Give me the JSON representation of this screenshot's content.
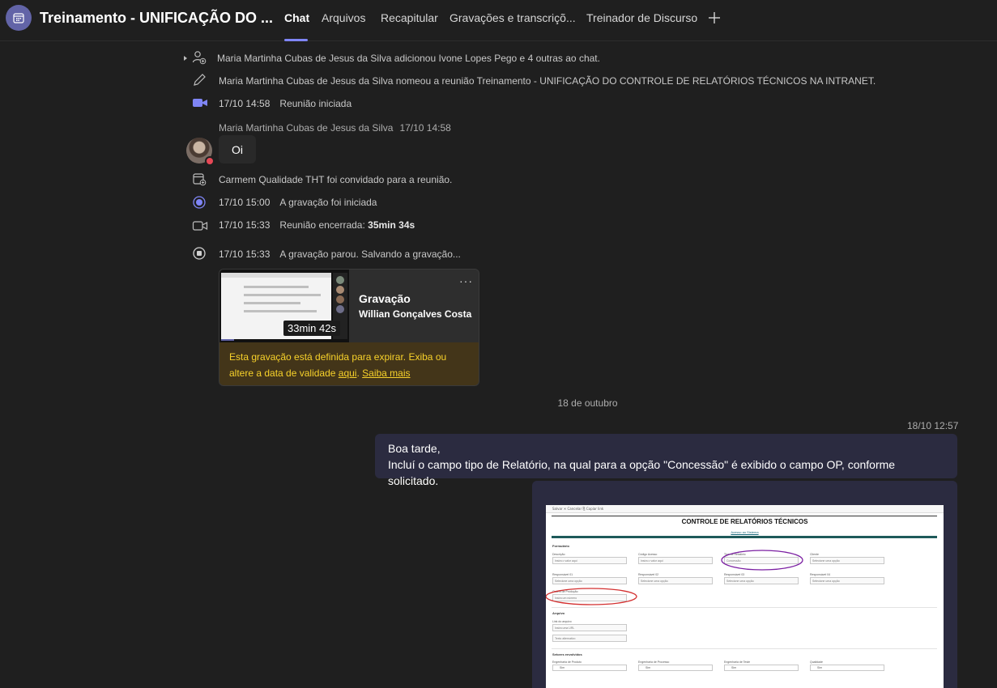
{
  "header": {
    "title": "Treinamento - UNIFICAÇÃO DO ...",
    "tabs": [
      {
        "label": "Chat",
        "active": true
      },
      {
        "label": "Arquivos"
      },
      {
        "label": "Recapitular"
      },
      {
        "label": "Gravações e transcriçõ..."
      },
      {
        "label": "Treinador de Discurso"
      }
    ],
    "add_tab_icon": "plus-icon",
    "accent_color": "#7f85f5"
  },
  "events": {
    "added": "Maria Martinha Cubas de Jesus da Silva adicionou Ivone Lopes Pego e 4 outras ao chat.",
    "renamed": "Maria Martinha Cubas de Jesus da Silva nomeou a reunião Treinamento - UNIFICAÇÃO DO CONTROLE DE RELATÓRIOS TÉCNICOS NA INTRANET.",
    "meeting_started": {
      "time": "17/10 14:58",
      "text": "Reunião iniciada"
    },
    "invited": "Carmem Qualidade THT foi convidado para a reunião.",
    "recording_started": {
      "time": "17/10 15:00",
      "text": "A gravação foi iniciada"
    },
    "meeting_ended": {
      "time": "17/10 15:33",
      "text": "Reunião encerrada:",
      "duration": "35min 34s"
    },
    "recording_stopped": {
      "time": "17/10 15:33",
      "text": "A gravação parou. Salvando a gravação..."
    }
  },
  "message_in": {
    "sender": "Maria Martinha Cubas de Jesus da Silva",
    "timestamp": "17/10 14:58",
    "text": "Oi",
    "presence_color": "#e74856"
  },
  "recording": {
    "duration": "33min 42s",
    "title": "Gravação",
    "owner": "Willian Gonçalves Costa",
    "more": "···",
    "warning_text": "Esta gravação está definida para expirar. Exiba ou altere a data de validade",
    "warning_link1": "aqui",
    "warning_sep": ".",
    "warning_link2": "Saiba mais",
    "warning_color": "#f8d22a"
  },
  "date_divider": "18 de outubro",
  "message_out": {
    "timestamp": "18/10 12:57",
    "line1": "Boa tarde,",
    "line2": "Incluí o campo tipo de Relatório, na qual para a opção \"Concessão\" é exibido o campo OP, conforme solicitado.",
    "bubble_color": "#2b2b40"
  },
  "attachment": {
    "toolbar": "Salvar   ✕ Cancelar   ⎘ Copiar link",
    "heading": "CONTROLE DE RELATÓRIOS TÉCNICOS",
    "sublink": "Acesso ao Sistema",
    "section_form": "Formulário",
    "fields": [
      {
        "label": "Descrição",
        "value": "Insira o valor aqui"
      },
      {
        "label": "Código Acesso",
        "value": "Insira o valor aqui"
      },
      {
        "label": "Tipo de Relatório",
        "value": "Concessão"
      },
      {
        "label": "Cliente",
        "value": "Selecione uma opção"
      },
      {
        "label": "Responsável 01",
        "value": "Selecione uma opção"
      },
      {
        "label": "Responsável 02",
        "value": "Selecione uma opção"
      },
      {
        "label": "Responsável 03",
        "value": "Selecione uma opção"
      },
      {
        "label": "Responsável 04",
        "value": "Selecione uma opção"
      },
      {
        "label": "Ordem de Produção",
        "value": "Insira um número"
      }
    ],
    "section_files": "Arquivo",
    "file_label": "Link do arquivo",
    "file_value": "Insira uma URL",
    "file_alt": "Texto alternativo",
    "section_sectors": "Setores envolvidos",
    "sectors": [
      {
        "label": "Engenharia de Produto",
        "option": "Sim"
      },
      {
        "label": "Engenharia de Processo",
        "option": "Sim"
      },
      {
        "label": "Engenharia de Teste",
        "option": "Sim"
      },
      {
        "label": "Qualidade",
        "option": "Sim"
      }
    ],
    "highlight_color": "#7b1fa2",
    "highlight_color2": "#d32f2f"
  }
}
